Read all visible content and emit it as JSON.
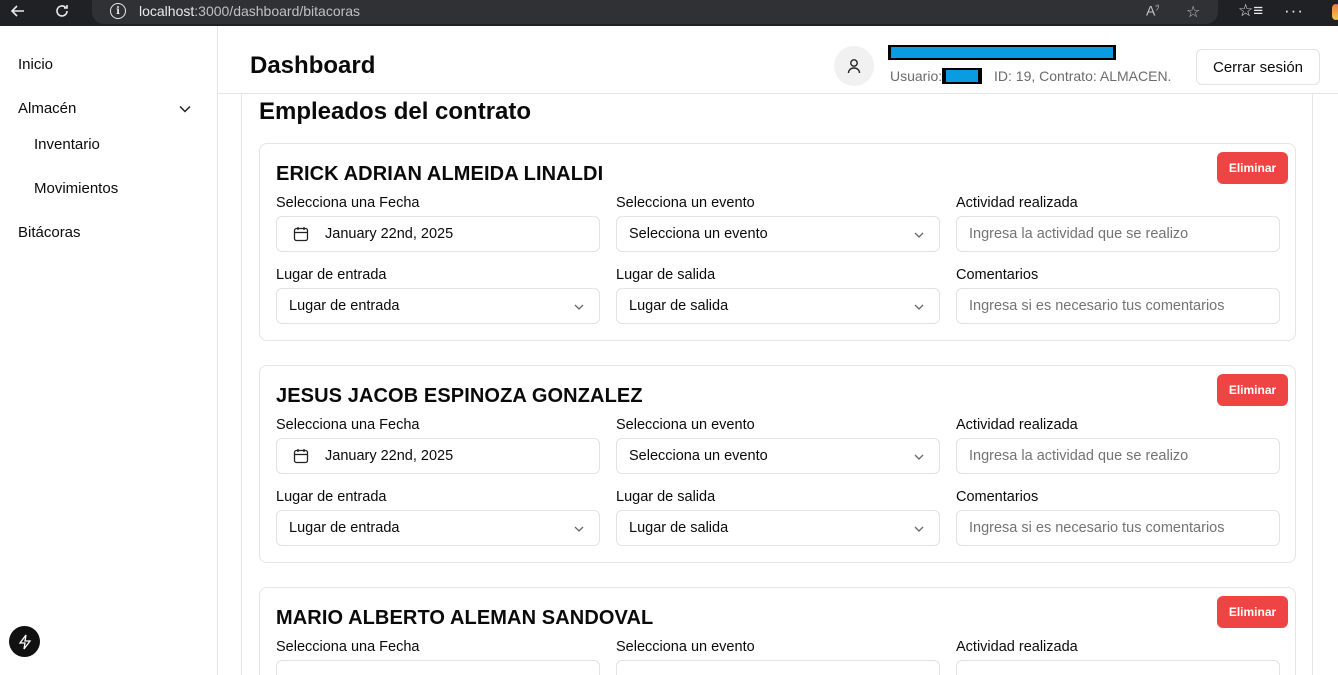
{
  "browser": {
    "url_host": "localhost",
    "url_path": ":3000/dashboard/bitacoras"
  },
  "sidebar": {
    "items": [
      {
        "label": "Inicio"
      },
      {
        "label": "Almacén"
      },
      {
        "label": "Inventario"
      },
      {
        "label": "Movimientos"
      },
      {
        "label": "Bitácoras"
      }
    ]
  },
  "header": {
    "title": "Dashboard",
    "user_label": "Usuario:",
    "user_meta": "ID: 19,  Contrato: ALMACEN.",
    "logout_label": "Cerrar sesión"
  },
  "main": {
    "section_title": "Empleados del contrato",
    "labels": {
      "date": "Selecciona una Fecha",
      "event": "Selecciona un evento",
      "activity": "Actividad realizada",
      "entry": "Lugar de entrada",
      "exit": "Lugar de salida",
      "comments": "Comentarios"
    },
    "delete_label": "Eliminar",
    "employees": [
      {
        "name": "ERICK ADRIAN ALMEIDA LINALDI",
        "date": "January 22nd, 2025",
        "event": "Selecciona un evento",
        "activity_placeholder": "Ingresa la actividad que se realizo",
        "entry": "Lugar de entrada",
        "exit": "Lugar de salida",
        "comments_placeholder": "Ingresa si es necesario tus comentarios"
      },
      {
        "name": "JESUS JACOB ESPINOZA GONZALEZ",
        "date": "January 22nd, 2025",
        "event": "Selecciona un evento",
        "activity_placeholder": "Ingresa la actividad que se realizo",
        "entry": "Lugar de entrada",
        "exit": "Lugar de salida",
        "comments_placeholder": "Ingresa si es necesario tus comentarios"
      },
      {
        "name": "MARIO ALBERTO ALEMAN SANDOVAL"
      }
    ]
  },
  "colors": {
    "danger": "#ef4444",
    "redaction": "#0a9ce0",
    "border": "#e5e5e5"
  }
}
